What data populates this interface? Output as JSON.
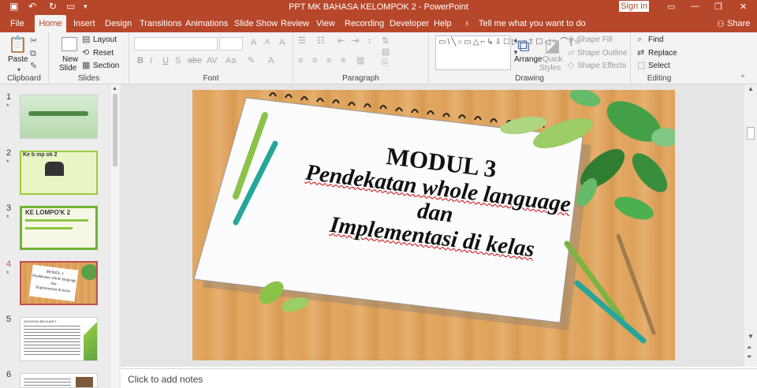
{
  "app": {
    "title": "PPT MK BAHASA KELOMPOK 2  -  PowerPoint",
    "signin": "Sign in"
  },
  "tabs": [
    "File",
    "Home",
    "Insert",
    "Design",
    "Transitions",
    "Animations",
    "Slide Show",
    "Review",
    "View",
    "Recording",
    "Developer",
    "Help"
  ],
  "tell_me": "Tell me what you want to do",
  "share": "Share",
  "ribbon": {
    "clipboard": {
      "label": "Clipboard",
      "paste": "Paste"
    },
    "slides": {
      "label": "Slides",
      "new_slide_1": "New",
      "new_slide_2": "Slide",
      "layout": "Layout",
      "reset": "Reset",
      "section": "Section"
    },
    "font": {
      "label": "Font"
    },
    "paragraph": {
      "label": "Paragraph"
    },
    "drawing": {
      "label": "Drawing",
      "arrange": "Arrange",
      "quick_styles_1": "Quick",
      "quick_styles_2": "Styles",
      "shape_fill": "Shape Fill",
      "shape_outline": "Shape Outline",
      "shape_effects": "Shape Effects"
    },
    "editing": {
      "label": "Editing",
      "find": "Find",
      "replace": "Replace",
      "select": "Select"
    }
  },
  "thumbnails": [
    {
      "num": "1",
      "star": "*"
    },
    {
      "num": "2",
      "star": "*",
      "title": "Ke   b  mp  ok   2"
    },
    {
      "num": "3",
      "star": "*",
      "title": "KE LOMPO'K 2"
    },
    {
      "num": "4",
      "star": "*",
      "l1": "MODUL 3",
      "l2": "Pendekatan whole language",
      "l3": "dan",
      "l4": "Implementasi  di kelas"
    },
    {
      "num": "5",
      "title": "KEGIATAN BELAJAR 1"
    },
    {
      "num": "6"
    }
  ],
  "slide": {
    "line1": "MODUL 3",
    "line2": "Pendekatan whole language",
    "line3": "dan",
    "line4": "Implementasi  di kelas"
  },
  "notes_placeholder": "Click to add notes"
}
